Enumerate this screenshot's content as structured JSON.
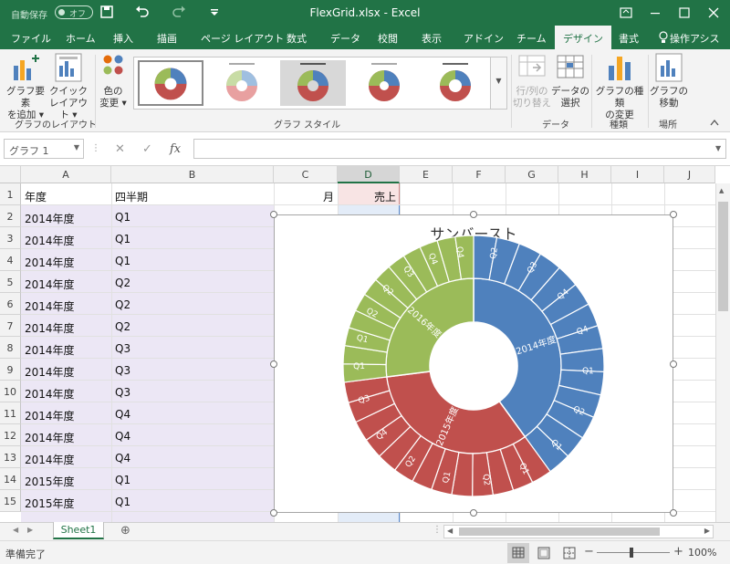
{
  "titlebar": {
    "autosave_label": "自動保存",
    "autosave_state": "オフ",
    "document_title": "FlexGrid.xlsx  -  Excel",
    "accent": "#217346"
  },
  "tabs": [
    {
      "label": "ファイル"
    },
    {
      "label": "ホーム"
    },
    {
      "label": "挿入"
    },
    {
      "label": "描画"
    },
    {
      "label": "ページ レイアウト"
    },
    {
      "label": "数式"
    },
    {
      "label": "データ"
    },
    {
      "label": "校閲"
    },
    {
      "label": "表示"
    },
    {
      "label": "アドイン"
    },
    {
      "label": "チーム"
    },
    {
      "label": "デザイン"
    },
    {
      "label": "書式"
    },
    {
      "label": "操作アシス"
    }
  ],
  "ribbon": {
    "add_element": [
      "グラフ要素",
      "を追加 ▾"
    ],
    "quick_layout": [
      "クイック",
      "レイアウト ▾"
    ],
    "group_layout": "グラフのレイアウト",
    "change_color": [
      "色の",
      "変更 ▾"
    ],
    "group_styles": "グラフ スタイル",
    "switch_rowcol": [
      "行/列の",
      "切り替え"
    ],
    "select_data": [
      "データの",
      "選択"
    ],
    "group_data": "データ",
    "change_type": [
      "グラフの種類",
      "の変更"
    ],
    "group_type": "種類",
    "move_chart": [
      "グラフの",
      "移動"
    ],
    "group_location": "場所"
  },
  "formula_bar": {
    "name_box": "グラフ 1",
    "fx": "fx"
  },
  "grid": {
    "columns": [
      "A",
      "B",
      "C",
      "D",
      "E",
      "F",
      "G",
      "H",
      "I",
      "J"
    ],
    "rows": [
      {
        "num": "1",
        "a": "年度",
        "b": "四半期",
        "c": "月",
        "d": "売上"
      },
      {
        "num": "2",
        "a": "2014年度",
        "b": "Q1"
      },
      {
        "num": "3",
        "a": "2014年度",
        "b": "Q1"
      },
      {
        "num": "4",
        "a": "2014年度",
        "b": "Q1"
      },
      {
        "num": "5",
        "a": "2014年度",
        "b": "Q2"
      },
      {
        "num": "6",
        "a": "2014年度",
        "b": "Q2"
      },
      {
        "num": "7",
        "a": "2014年度",
        "b": "Q2"
      },
      {
        "num": "8",
        "a": "2014年度",
        "b": "Q3"
      },
      {
        "num": "9",
        "a": "2014年度",
        "b": "Q3"
      },
      {
        "num": "10",
        "a": "2014年度",
        "b": "Q3"
      },
      {
        "num": "11",
        "a": "2014年度",
        "b": "Q4"
      },
      {
        "num": "12",
        "a": "2014年度",
        "b": "Q4"
      },
      {
        "num": "13",
        "a": "2014年度",
        "b": "Q4"
      },
      {
        "num": "14",
        "a": "2015年度",
        "b": "Q1"
      },
      {
        "num": "15",
        "a": "2015年度",
        "b": "Q1"
      }
    ],
    "range_highlight": "#ece7f5",
    "data_highlight": "#e3ecf8"
  },
  "chart": {
    "title": "サンバースト",
    "years": [
      {
        "label": "2014年度",
        "color": "#4f81bd",
        "share": 0.4
      },
      {
        "label": "2015年度",
        "color": "#c0504d",
        "share": 0.33
      },
      {
        "label": "2016年度",
        "color": "#9bbb59",
        "share": 0.27
      }
    ],
    "outer_labels": [
      {
        "text": "Q2",
        "year": 0
      },
      {
        "text": "Q3",
        "year": 0
      },
      {
        "text": "Q4",
        "year": 0
      },
      {
        "text": "Q4",
        "year": 0
      },
      {
        "text": "Q1",
        "year": 0
      },
      {
        "text": "Q2",
        "year": 0
      },
      {
        "text": "Q1",
        "year": 0
      },
      {
        "text": "Q1",
        "year": 1
      },
      {
        "text": "Q2",
        "year": 1
      },
      {
        "text": "Q1",
        "year": 1
      },
      {
        "text": "Q2",
        "year": 1
      },
      {
        "text": "Q4",
        "year": 1
      },
      {
        "text": "Q3",
        "year": 1
      },
      {
        "text": "Q1",
        "year": 2
      },
      {
        "text": "Q1",
        "year": 2
      },
      {
        "text": "Q2",
        "year": 2
      },
      {
        "text": "Q2",
        "year": 2
      },
      {
        "text": "Q3",
        "year": 2
      },
      {
        "text": "Q4",
        "year": 2
      },
      {
        "text": "Q4",
        "year": 2
      }
    ]
  },
  "sheetbar": {
    "sheet_name": "Sheet1",
    "add_sheet": "⊕"
  },
  "status": {
    "ready": "準備完了",
    "zoom": "100%"
  }
}
